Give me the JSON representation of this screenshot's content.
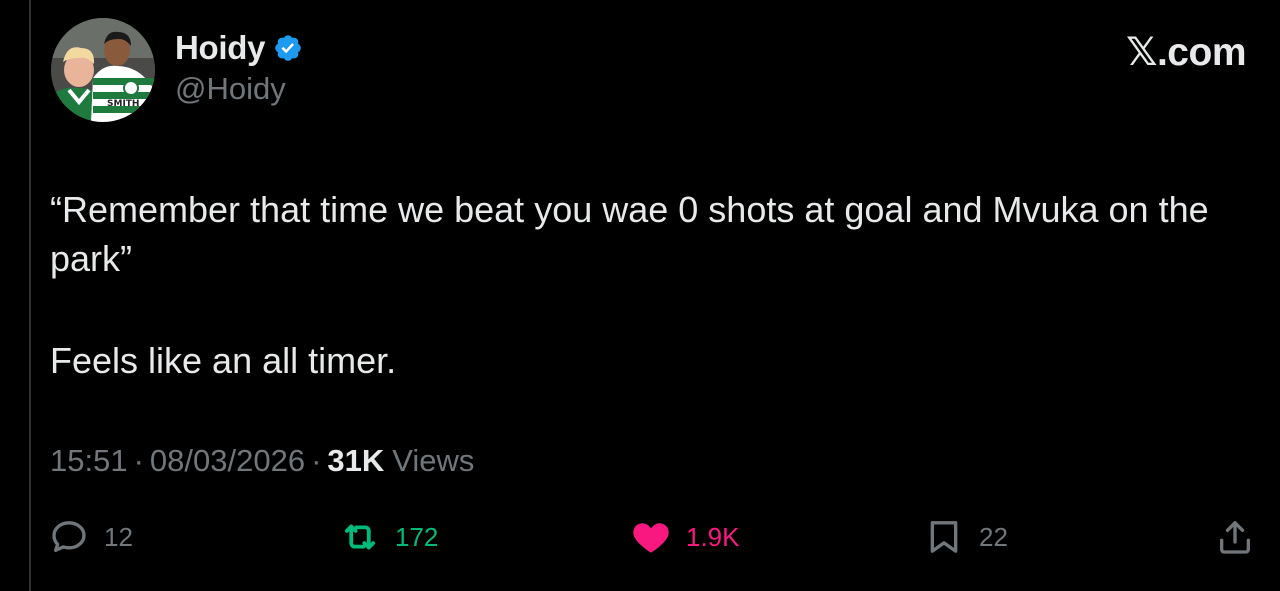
{
  "author": {
    "display_name": "Hoidy",
    "handle": "@Hoidy",
    "verified_icon": "verified-badge-icon",
    "avatar_icon": "profile-photo",
    "avatar_shirt_text": "SMITH"
  },
  "brand": {
    "text": "X.com",
    "glyph": "𝕏",
    "suffix": ".com"
  },
  "tweet": {
    "paragraphs": [
      "“Remember that time we beat you wae 0 shots at goal and Mvuka on the park”",
      "Feels like an all timer."
    ]
  },
  "meta": {
    "time": "15:51",
    "separator": "·",
    "date": "08/03/2026",
    "views_count": "31K",
    "views_label": "Views"
  },
  "actions": {
    "reply": {
      "icon": "reply-icon",
      "count": "12"
    },
    "retweet": {
      "icon": "retweet-icon",
      "count": "172"
    },
    "like": {
      "icon": "heart-icon",
      "count": "1.9K"
    },
    "bookmark": {
      "icon": "bookmark-icon",
      "count": "22"
    },
    "share": {
      "icon": "share-icon"
    }
  },
  "colors": {
    "background": "#000000",
    "text_primary": "#e7e9ea",
    "text_secondary": "#71767b",
    "verified": "#1d9bf0",
    "retweet": "#00ba7c",
    "like": "#f91880"
  }
}
